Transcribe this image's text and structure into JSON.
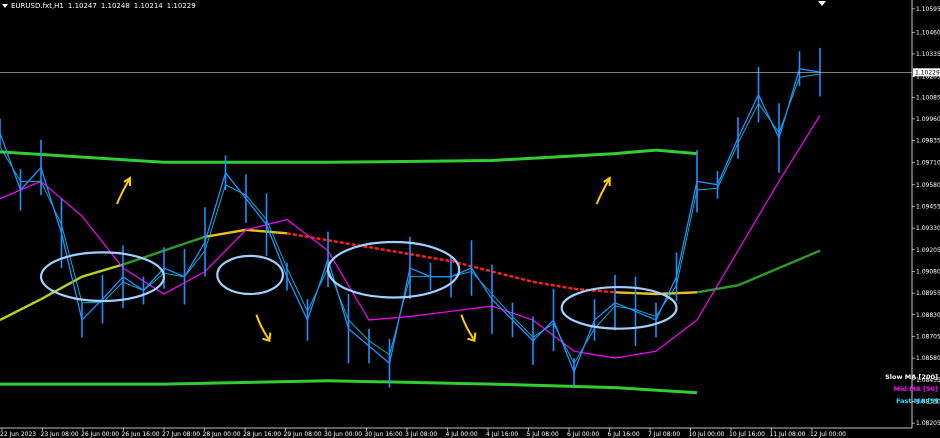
{
  "window": {
    "symbol": "EURUSD.fxt,H1",
    "ohlc": [
      "1.10247",
      "1.10248",
      "1.10214",
      "1.10229"
    ]
  },
  "indicators": [
    {
      "label": "Slow MA [200]",
      "color": "#ffffff"
    },
    {
      "label": "Mid MA [50]",
      "color": "#ff00ff"
    },
    {
      "label": "Fast MA [5]",
      "color": "#00e5ff"
    }
  ],
  "colors": {
    "background": "#000000",
    "price": "#1e90ff",
    "slow_ma_flat": "#e8c020",
    "slow_ma_down": "#ff2020",
    "slow_ma_up": "#2e9a2e",
    "mid_ma": "#ff00ff",
    "fast_ma": "#00e5ff",
    "channel": "#33cc33",
    "annotations_ellipse": "#9fd0ff",
    "annotations_arrow": "#ffd000"
  },
  "chart_data": {
    "type": "line",
    "ylim": [
      1.082,
      1.106
    ],
    "y_ticks": [
      "1.10595",
      "1.10460",
      "1.10335",
      "1.10205",
      "1.10085",
      "1.09960",
      "1.09835",
      "1.09710",
      "1.09580",
      "1.09455",
      "1.09330",
      "1.09205",
      "1.09080",
      "1.08955",
      "1.08830",
      "1.08705",
      "1.08580",
      "1.08455",
      "1.08330",
      "1.08205"
    ],
    "x_ticks": [
      "22 Jun 2023",
      "23 Jun 08:00",
      "26 Jun 00:00",
      "26 Jun 16:00",
      "27 Jun 08:00",
      "28 Jun 00:00",
      "28 Jun 16:00",
      "29 Jun 08:00",
      "30 Jun 00:00",
      "30 Jun 16:00",
      "3 Jul 08:00",
      "4 Jul 00:00",
      "4 Jul 16:00",
      "5 Jul 08:00",
      "6 Jul 00:00",
      "6 Jul 16:00",
      "7 Jul 08:00",
      "10 Jul 00:00",
      "10 Jul 16:00",
      "11 Jul 08:00",
      "12 Jul 00:00"
    ],
    "current_price": "1.10229",
    "current_price_value": 1.10229,
    "series": [
      {
        "name": "EURUSD.fxt,H1",
        "x": [
          0,
          5,
          10,
          15,
          20,
          25,
          30,
          35,
          40,
          45,
          50,
          55,
          60,
          65,
          70,
          75,
          80,
          85,
          90,
          95,
          100,
          105,
          110,
          115,
          120,
          125,
          130,
          135,
          140,
          145,
          150,
          155,
          160,
          165,
          170,
          175,
          180,
          185,
          190,
          195,
          200
        ],
        "y": [
          1.0988,
          1.0955,
          1.0968,
          1.093,
          1.088,
          1.0892,
          1.0905,
          1.0897,
          1.091,
          1.0905,
          1.0925,
          1.0965,
          1.095,
          1.0935,
          1.0905,
          1.088,
          1.0915,
          1.0875,
          1.0865,
          1.0855,
          1.091,
          1.0905,
          1.0905,
          1.091,
          1.0892,
          1.088,
          1.0868,
          1.088,
          1.085,
          1.088,
          1.089,
          1.0885,
          1.088,
          1.0905,
          1.096,
          1.0958,
          1.0985,
          1.101,
          1.0985,
          1.1025,
          1.1023
        ]
      },
      {
        "name": "Fast MA [5]",
        "x": [
          0,
          5,
          10,
          15,
          20,
          25,
          30,
          35,
          40,
          45,
          50,
          55,
          60,
          65,
          70,
          75,
          80,
          85,
          90,
          95,
          100,
          105,
          110,
          115,
          120,
          125,
          130,
          135,
          140,
          145,
          150,
          155,
          160,
          165,
          170,
          175,
          180,
          185,
          190,
          195,
          200
        ],
        "y": [
          1.098,
          1.096,
          1.096,
          1.0935,
          1.089,
          1.089,
          1.0902,
          1.0897,
          1.0907,
          1.0905,
          1.092,
          1.0958,
          1.0952,
          1.0938,
          1.091,
          1.0885,
          1.091,
          1.088,
          1.0868,
          1.086,
          1.0905,
          1.0905,
          1.0905,
          1.0908,
          1.0895,
          1.0882,
          1.087,
          1.0878,
          1.0855,
          1.0875,
          1.0888,
          1.0886,
          1.0882,
          1.09,
          1.0955,
          1.0956,
          1.0982,
          1.1005,
          1.0988,
          1.102,
          1.1022
        ]
      },
      {
        "name": "Mid MA [50]",
        "x": [
          0,
          10,
          20,
          30,
          40,
          50,
          60,
          70,
          80,
          90,
          100,
          110,
          120,
          130,
          140,
          150,
          160,
          170,
          180,
          190,
          200
        ],
        "y": [
          1.095,
          1.096,
          1.094,
          1.091,
          1.0895,
          1.0908,
          1.0932,
          1.0938,
          1.092,
          1.088,
          1.0882,
          1.0885,
          1.0888,
          1.088,
          1.0862,
          1.0858,
          1.0862,
          1.088,
          1.092,
          1.096,
          1.0998
        ]
      },
      {
        "name": "Slow MA [200]",
        "x": [
          0,
          10,
          20,
          30,
          40,
          50,
          60,
          70,
          80,
          90,
          100,
          110,
          120,
          130,
          140,
          150,
          160,
          170,
          180,
          190,
          200
        ],
        "y": [
          1.088,
          1.0892,
          1.0905,
          1.0912,
          1.092,
          1.0928,
          1.0932,
          1.093,
          1.0926,
          1.0922,
          1.0918,
          1.0914,
          1.0908,
          1.0902,
          1.0898,
          1.0896,
          1.0895,
          1.0896,
          1.09,
          1.091,
          1.092
        ]
      }
    ],
    "channel_upper": {
      "x": [
        0,
        40,
        80,
        120,
        150,
        160,
        170
      ],
      "y": [
        1.0977,
        1.0971,
        1.0971,
        1.0972,
        1.0976,
        1.0978,
        1.0976
      ]
    },
    "channel_lower": {
      "x": [
        0,
        40,
        80,
        120,
        150,
        170
      ],
      "y": [
        1.0843,
        1.0843,
        1.0845,
        1.0843,
        1.0841,
        1.0838
      ]
    },
    "annotations": {
      "ellipses": [
        {
          "cx": 25,
          "cy": 1.0905,
          "rx": 15,
          "ry": 0.0014
        },
        {
          "cx": 61,
          "cy": 1.0906,
          "rx": 8,
          "ry": 0.0011
        },
        {
          "cx": 96,
          "cy": 1.0909,
          "rx": 16,
          "ry": 0.0016
        },
        {
          "cx": 151,
          "cy": 1.0887,
          "rx": 14,
          "ry": 0.0012
        }
      ],
      "up_arrows": [
        {
          "x": 30,
          "y": 1.0955
        },
        {
          "x": 147,
          "y": 1.0955
        }
      ],
      "down_arrows": [
        {
          "x": 64,
          "y": 1.0875
        },
        {
          "x": 114,
          "y": 1.0875
        }
      ]
    }
  }
}
